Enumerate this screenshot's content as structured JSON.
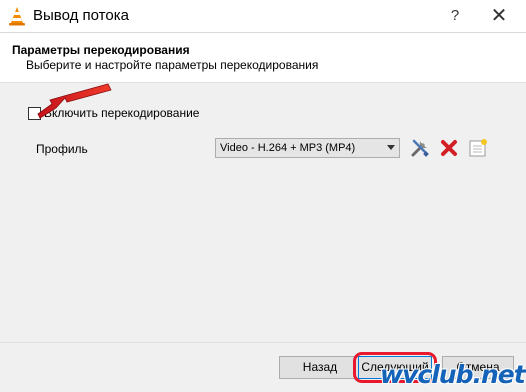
{
  "window": {
    "title": "Вывод потока",
    "help_glyph": "?",
    "close_glyph": "✕"
  },
  "header": {
    "title": "Параметры перекодирования",
    "subtitle": "Выберите и настройте параметры перекодирования"
  },
  "transcode": {
    "checkbox_label": "Включить перекодирование",
    "checked": false
  },
  "profile": {
    "label": "Профиль",
    "selected": "Video - H.264 + MP3 (MP4)"
  },
  "buttons": {
    "back": "Назад",
    "next": "Следующий",
    "cancel": "Отмена"
  },
  "watermark": "wvclub.net",
  "colors": {
    "highlight": "#e8192c",
    "watermark": "#1463b8"
  }
}
